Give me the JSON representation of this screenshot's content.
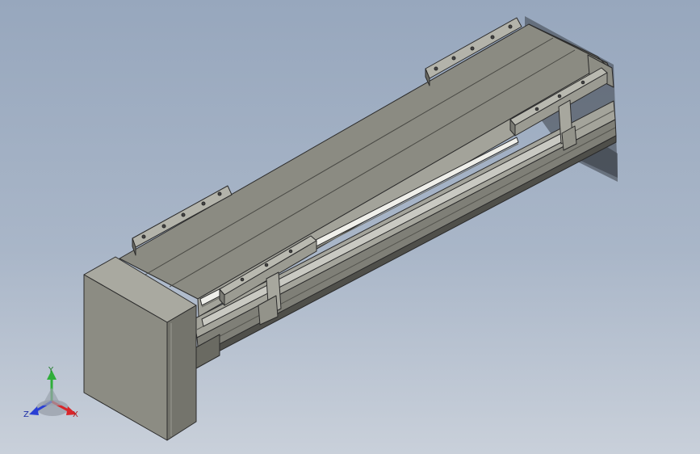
{
  "view": {
    "background_top": "#97a7bd",
    "background_bottom": "#c9d0da"
  },
  "triad": {
    "x_label": "X",
    "y_label": "Y",
    "z_label": "Z",
    "x_color": "#d8262a",
    "y_color": "#2fae3a",
    "z_color": "#2a3fd4"
  },
  "model": {
    "body_color": "#8d8d84",
    "edge_color": "#2b2b2b",
    "rail_color": "#e9e9e4"
  }
}
